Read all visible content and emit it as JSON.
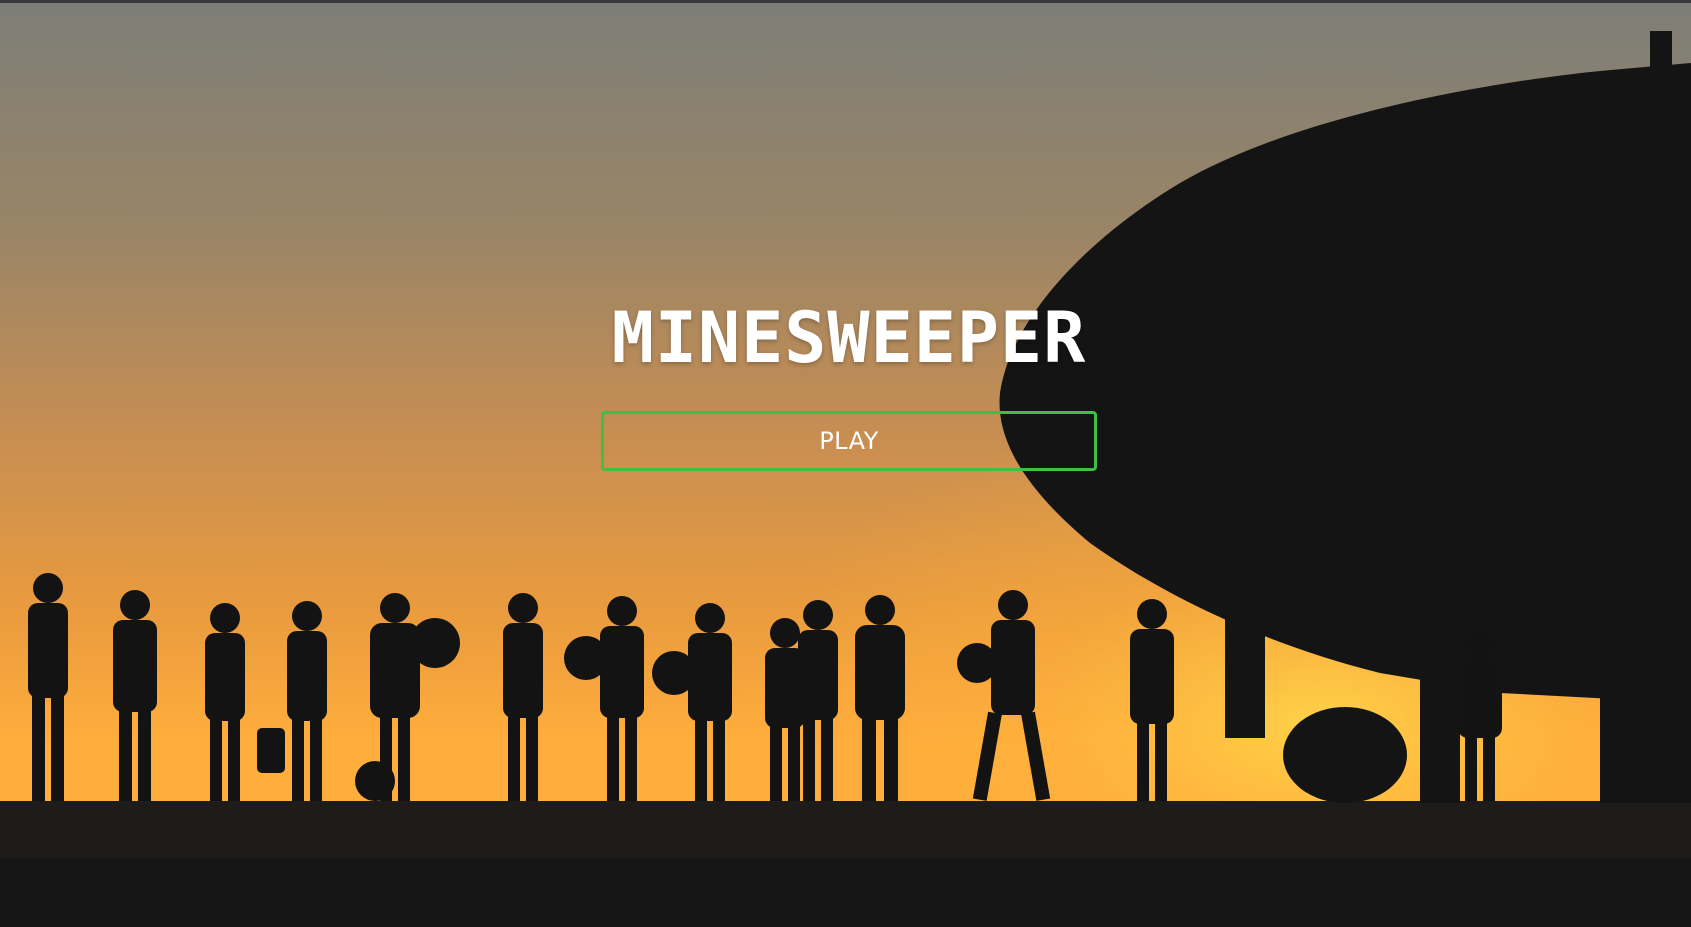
{
  "title": "MINESWEEPER",
  "play_button": {
    "label": "PLAY",
    "border_color": "#3fbf45"
  },
  "background": {
    "sky_top": "#7d7e78",
    "sky_mid": "#c48d54",
    "sky_bottom": "#ffad3c",
    "silhouette": "#121212"
  }
}
